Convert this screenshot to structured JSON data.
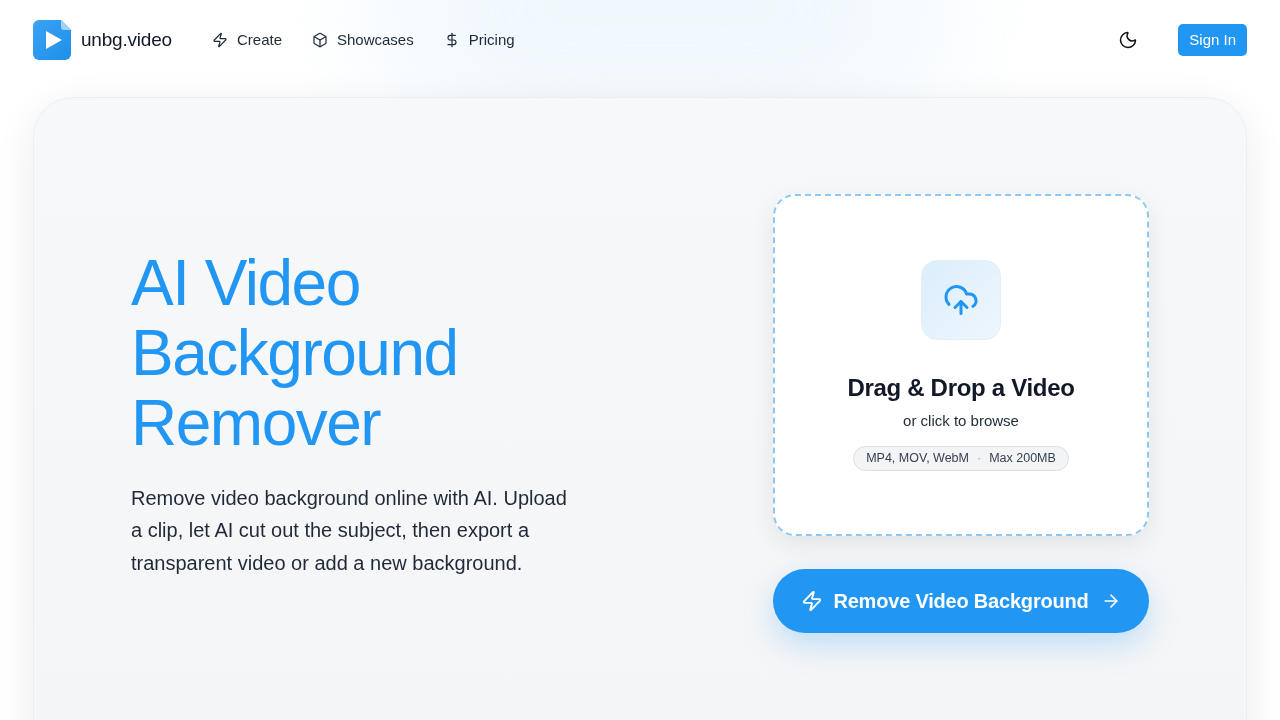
{
  "header": {
    "brand": "unbg.video",
    "nav": [
      {
        "label": "Create"
      },
      {
        "label": "Showcases"
      },
      {
        "label": "Pricing"
      }
    ],
    "sign_in": "Sign In"
  },
  "hero": {
    "title": "AI Video Background Remover",
    "description": "Remove video background online with AI. Upload a clip, let AI cut out the subject, then export a transparent video or add a new background."
  },
  "upload": {
    "title": "Drag & Drop a Video",
    "subtitle": "or click to browse",
    "formats": "MP4, MOV, WebM",
    "separator": "·",
    "limit": "Max 200MB"
  },
  "action": {
    "label": "Remove Video Background"
  }
}
